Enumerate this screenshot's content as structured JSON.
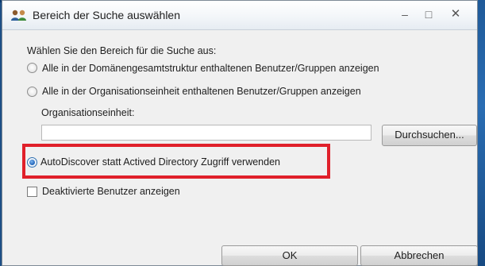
{
  "window": {
    "title": "Bereich der Suche auswählen",
    "controls": {
      "minimize": "–",
      "maximize": "□",
      "close": "✕"
    }
  },
  "dialog": {
    "prompt": "Wählen Sie den Bereich für die Suche aus:",
    "options": [
      {
        "label": "Alle in der Domänengesamtstruktur enthaltenen Benutzer/Gruppen anzeigen",
        "selected": false
      },
      {
        "label": "Alle in der Organisationseinheit enthaltenen Benutzer/Gruppen anzeigen",
        "selected": false
      },
      {
        "label": "AutoDiscover statt Actived Directory Zugriff verwenden",
        "selected": true
      }
    ],
    "ou_label": "Organisationseinheit:",
    "ou_value": "",
    "browse_button": "Durchsuchen...",
    "checkbox_label": "Deaktivierte Benutzer anzeigen",
    "checkbox_checked": false,
    "ok_button": "OK",
    "cancel_button": "Abbrechen"
  },
  "colors": {
    "highlight": "#e0202a",
    "window_bg": "#f0f0f0",
    "desktop": "#1d4f86"
  }
}
